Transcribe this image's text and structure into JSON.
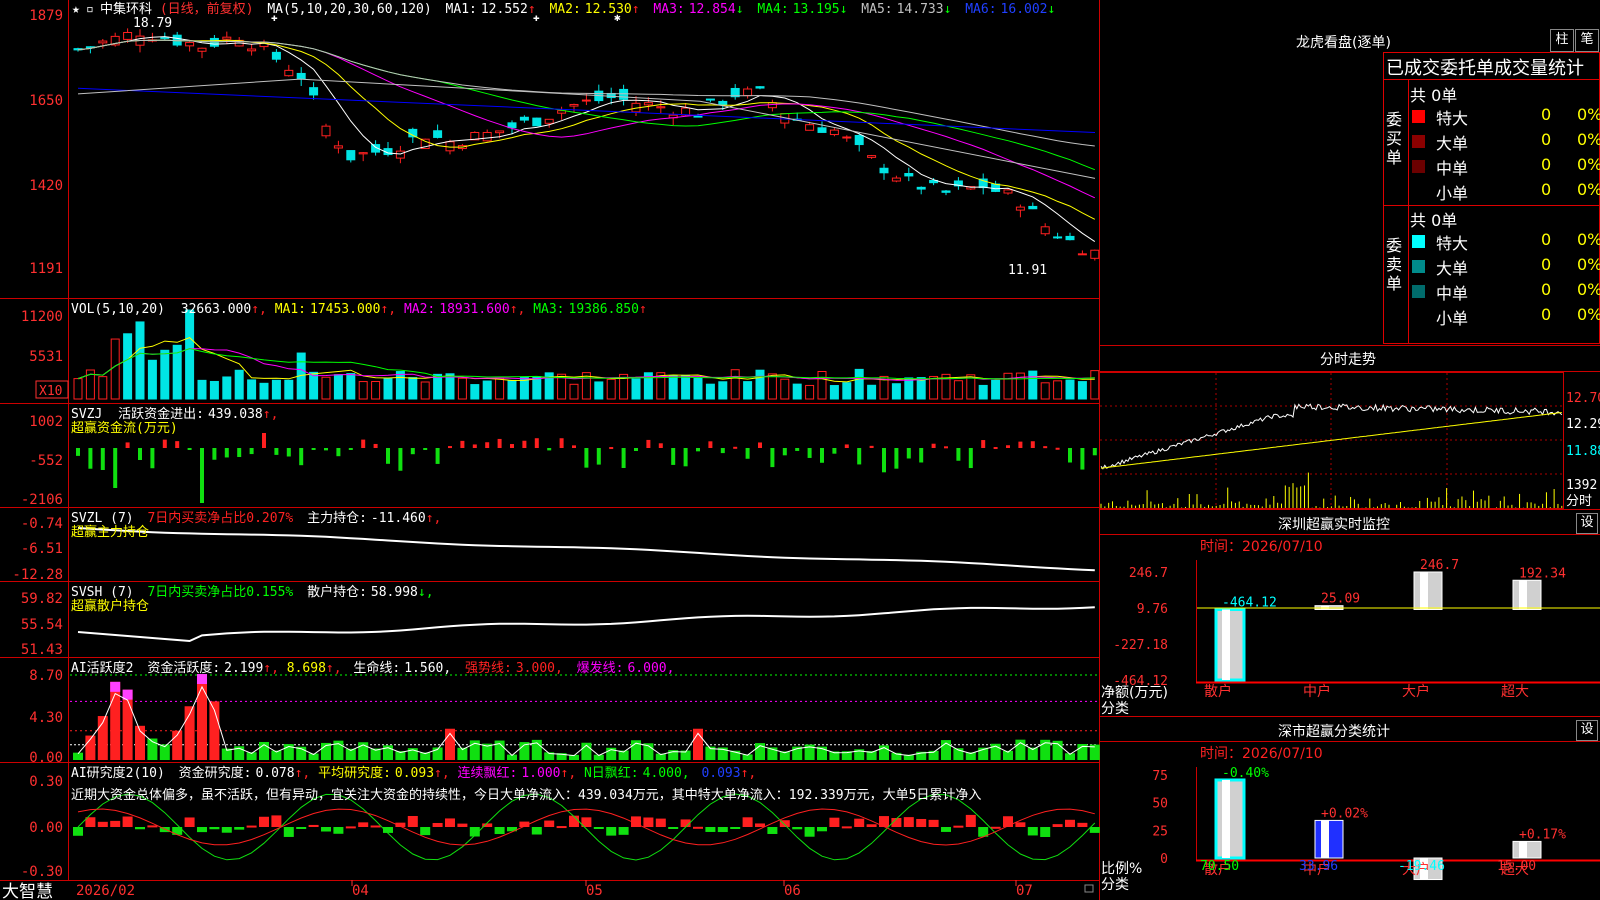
{
  "app": {
    "name": "大智慧",
    "stock": "中集环科",
    "period": "日线，前复权"
  },
  "main": {
    "ma_title": "MA(5,10,20,30,60,120)",
    "ma": [
      {
        "label": "MA1:",
        "value": "12.552",
        "arrow": "↑",
        "color": "#ffffff"
      },
      {
        "label": "MA2:",
        "value": "12.530",
        "arrow": "↑",
        "color": "#ffff00"
      },
      {
        "label": "MA3:",
        "value": "12.854",
        "arrow": "↓",
        "color": "#ff00ff"
      },
      {
        "label": "MA4:",
        "value": "13.195",
        "arrow": "↓",
        "color": "#00ff00"
      },
      {
        "label": "MA5:",
        "value": "14.733",
        "arrow": "↓",
        "color": "#c0c0c0"
      },
      {
        "label": "MA6:",
        "value": "16.002",
        "arrow": "↓",
        "color": "#0000ff"
      }
    ],
    "yticks": [
      "1879",
      "1650",
      "1420",
      "1191"
    ],
    "high_label": "18.79",
    "low_label": "11.91"
  },
  "vol": {
    "title": "VOL(5,10,20)",
    "value": "32663.000",
    "ma": [
      {
        "label": "MA1:",
        "value": "17453.000",
        "color": "#ffff00"
      },
      {
        "label": "MA2:",
        "value": "18931.600",
        "color": "#ff00ff"
      },
      {
        "label": "MA3:",
        "value": "19386.850",
        "color": "#00ff00"
      }
    ],
    "yticks": [
      "11200",
      "5531"
    ],
    "unit": "X10"
  },
  "svzj": {
    "title": "SVZJ",
    "label": "活跃资金进出:",
    "value": "439.038",
    "sub": "超赢资金流(万元)",
    "yticks": [
      "1002",
      "-552",
      "-2106"
    ]
  },
  "svzl": {
    "title": "SVZL (7)",
    "ratio": "7日内买卖净占比0.207%",
    "label": "主力持仓:",
    "value": "-11.460",
    "sub": "超赢主力持仓",
    "yticks": [
      "-0.74",
      "-6.51",
      "-12.28"
    ]
  },
  "svsh": {
    "title": "SVSH (7)",
    "ratio": "7日内买卖净占比0.155%",
    "label": "散户持仓:",
    "value": "58.998",
    "sub": "超赢散户持仓",
    "yticks": [
      "59.82",
      "55.54",
      "51.43"
    ]
  },
  "ai2": {
    "title": "AI活跃度2",
    "label": "资金活跃度:",
    "value": "2.199",
    "v2": "8.698",
    "life_label": "生命线:",
    "life": "1.560",
    "strong_label": "强势线:",
    "strong": "3.000",
    "burst_label": "爆发线:",
    "burst": "6.000",
    "yticks": [
      "8.70",
      "4.30",
      "0.00"
    ]
  },
  "ai_res": {
    "title": "AI研究度2(10)",
    "label": "资金研究度:",
    "value": "0.078",
    "avg_label": "平均研究度:",
    "avg": "0.093",
    "cont_label": "连续飘红:",
    "cont": "1.000",
    "n_label": "N日飘红:",
    "n": "4.000",
    "v5": "0.093",
    "text": "近期大资金总体偏多，虽不活跃，但有异动，宜关注大资金的持续性，今日大单净流入：439.034万元，其中特大单净流入：192.339万元，大单5日累计净入",
    "yticks": [
      "0.30",
      "0.00",
      "-0.30"
    ]
  },
  "xaxis": [
    "2026/02",
    "04",
    "05",
    "06",
    "07"
  ],
  "dragon": {
    "title": "龙虎看盘(逐单)",
    "btn_bar": "柱",
    "btn_pen": "笔",
    "header": "已成交委托单成交量统计",
    "buy": {
      "label": "委买单",
      "total": "共 0单",
      "rows": [
        {
          "name": "特大",
          "count": "0",
          "pct": "0%",
          "color": "#ff0000"
        },
        {
          "name": "大单",
          "count": "0",
          "pct": "0%",
          "color": "#8b0000"
        },
        {
          "name": "中单",
          "count": "0",
          "pct": "0%",
          "color": "#6b0000"
        },
        {
          "name": "小单",
          "count": "0",
          "pct": "0%",
          "color": "#000000"
        }
      ]
    },
    "sell": {
      "label": "委卖单",
      "total": "共 0单",
      "rows": [
        {
          "name": "特大",
          "count": "0",
          "pct": "0%",
          "color": "#00ffff"
        },
        {
          "name": "大单",
          "count": "0",
          "pct": "0%",
          "color": "#008b8b"
        },
        {
          "name": "中单",
          "count": "0",
          "pct": "0%",
          "color": "#006b6b"
        },
        {
          "name": "小单",
          "count": "0",
          "pct": "0%",
          "color": "#000000"
        }
      ]
    }
  },
  "intraday": {
    "title": "分时走势",
    "prices": [
      "12.70",
      "12.29",
      "11.88"
    ],
    "vol_top": "1392",
    "vol_bottom": "分时"
  },
  "sz_monitor": {
    "title": "深圳超赢实时监控",
    "btn": "设",
    "time_label": "时间：2026/07/10",
    "yticks": [
      "246.7",
      "9.76",
      "-227.18",
      "-464.12"
    ],
    "ylabel": "净额(万元)",
    "xlabel": "分类",
    "bars": [
      {
        "name": "散户",
        "value": -464.12,
        "label": "-464.12"
      },
      {
        "name": "中户",
        "value": 25.09,
        "label": "25.09"
      },
      {
        "name": "大户",
        "value": 246.7,
        "label": "246.7"
      },
      {
        "name": "超大",
        "value": 192.34,
        "label": "192.34"
      }
    ]
  },
  "sz_class": {
    "title": "深市超赢分类统计",
    "btn": "设",
    "time_label": "时间：2026/07/10",
    "yticks": [
      "75",
      "50",
      "25",
      "0"
    ],
    "ylabel": "比例%",
    "xlabel": "分类",
    "bars": [
      {
        "name": "散户",
        "value": 70.5,
        "label": "70.50",
        "change": "-0.40%"
      },
      {
        "name": "中户",
        "value": 33.96,
        "label": "33.96",
        "change": "+0.02%"
      },
      {
        "name": "大户",
        "value": -19.46,
        "label": "-19.46",
        "change": ""
      },
      {
        "name": "超大",
        "value": 15.0,
        "label": "15.00",
        "change": "+0.17%"
      }
    ]
  }
}
